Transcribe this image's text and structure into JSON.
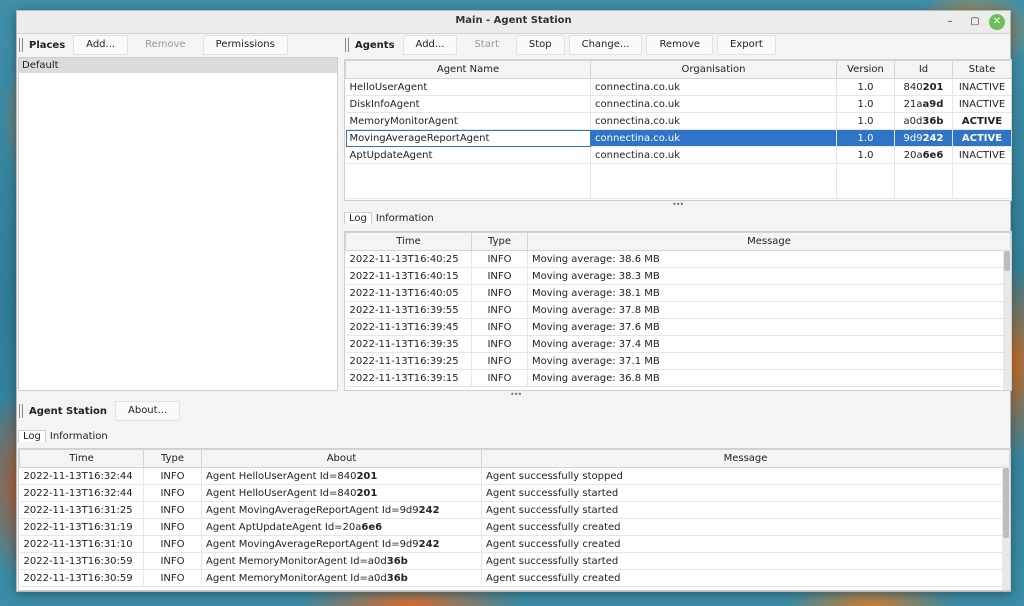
{
  "window": {
    "title": "Main - Agent Station",
    "minimize_glyph": "–",
    "maximize_glyph": "▢",
    "close_glyph": "✕"
  },
  "places": {
    "title": "Places",
    "buttons": {
      "add": "Add...",
      "remove": "Remove",
      "permissions": "Permissions"
    },
    "items": [
      "Default"
    ]
  },
  "agents": {
    "title": "Agents",
    "buttons": {
      "add": "Add...",
      "start": "Start",
      "stop": "Stop",
      "change": "Change...",
      "remove": "Remove",
      "export": "Export"
    },
    "columns": [
      "Agent Name",
      "Organisation",
      "Version",
      "Id",
      "State"
    ],
    "rows": [
      {
        "name": "HelloUserAgent",
        "org": "connectina.co.uk",
        "version": "1.0",
        "id_prefix": "840",
        "id_bold": "201",
        "state": "INACTIVE"
      },
      {
        "name": "DiskInfoAgent",
        "org": "connectina.co.uk",
        "version": "1.0",
        "id_prefix": "21a",
        "id_bold": "a9d",
        "state": "INACTIVE"
      },
      {
        "name": "MemoryMonitorAgent",
        "org": "connectina.co.uk",
        "version": "1.0",
        "id_prefix": "a0d",
        "id_bold": "36b",
        "state": "ACTIVE"
      },
      {
        "name": "MovingAverageReportAgent",
        "org": "connectina.co.uk",
        "version": "1.0",
        "id_prefix": "9d9",
        "id_bold": "242",
        "state": "ACTIVE"
      },
      {
        "name": "AptUpdateAgent",
        "org": "connectina.co.uk",
        "version": "1.0",
        "id_prefix": "20a",
        "id_bold": "6e6",
        "state": "INACTIVE"
      }
    ],
    "selected_index": 3
  },
  "agent_log": {
    "tabs": [
      "Log",
      "Information"
    ],
    "columns": [
      "Time",
      "Type",
      "Message"
    ],
    "rows": [
      {
        "time": "2022-11-13T16:40:25",
        "type": "INFO",
        "message": "Moving average:  38.6 MB"
      },
      {
        "time": "2022-11-13T16:40:15",
        "type": "INFO",
        "message": "Moving average:  38.3 MB"
      },
      {
        "time": "2022-11-13T16:40:05",
        "type": "INFO",
        "message": "Moving average:  38.1 MB"
      },
      {
        "time": "2022-11-13T16:39:55",
        "type": "INFO",
        "message": "Moving average:  37.8 MB"
      },
      {
        "time": "2022-11-13T16:39:45",
        "type": "INFO",
        "message": "Moving average:  37.6 MB"
      },
      {
        "time": "2022-11-13T16:39:35",
        "type": "INFO",
        "message": "Moving average:  37.4 MB"
      },
      {
        "time": "2022-11-13T16:39:25",
        "type": "INFO",
        "message": "Moving average:  37.1 MB"
      },
      {
        "time": "2022-11-13T16:39:15",
        "type": "INFO",
        "message": "Moving average:  36.8 MB"
      }
    ]
  },
  "station": {
    "title": "Agent Station",
    "buttons": {
      "about": "About..."
    },
    "tabs": [
      "Log",
      "Information"
    ],
    "columns": [
      "Time",
      "Type",
      "About",
      "Message"
    ],
    "rows": [
      {
        "time": "2022-11-13T16:32:44",
        "type": "INFO",
        "about_prefix": "Agent HelloUserAgent Id=840",
        "about_bold": "201",
        "message": "Agent successfully stopped"
      },
      {
        "time": "2022-11-13T16:32:44",
        "type": "INFO",
        "about_prefix": "Agent HelloUserAgent Id=840",
        "about_bold": "201",
        "message": "Agent successfully started"
      },
      {
        "time": "2022-11-13T16:31:25",
        "type": "INFO",
        "about_prefix": "Agent MovingAverageReportAgent Id=9d9",
        "about_bold": "242",
        "message": "Agent successfully started"
      },
      {
        "time": "2022-11-13T16:31:19",
        "type": "INFO",
        "about_prefix": "Agent AptUpdateAgent Id=20a",
        "about_bold": "6e6",
        "message": "Agent successfully created"
      },
      {
        "time": "2022-11-13T16:31:10",
        "type": "INFO",
        "about_prefix": "Agent MovingAverageReportAgent Id=9d9",
        "about_bold": "242",
        "message": "Agent successfully created"
      },
      {
        "time": "2022-11-13T16:30:59",
        "type": "INFO",
        "about_prefix": "Agent MemoryMonitorAgent Id=a0d",
        "about_bold": "36b",
        "message": "Agent successfully started"
      },
      {
        "time": "2022-11-13T16:30:59",
        "type": "INFO",
        "about_prefix": "Agent MemoryMonitorAgent Id=a0d",
        "about_bold": "36b",
        "message": "Agent successfully created"
      }
    ]
  },
  "colors": {
    "selection": "#2f74c7",
    "close_button": "#6cbf57"
  }
}
